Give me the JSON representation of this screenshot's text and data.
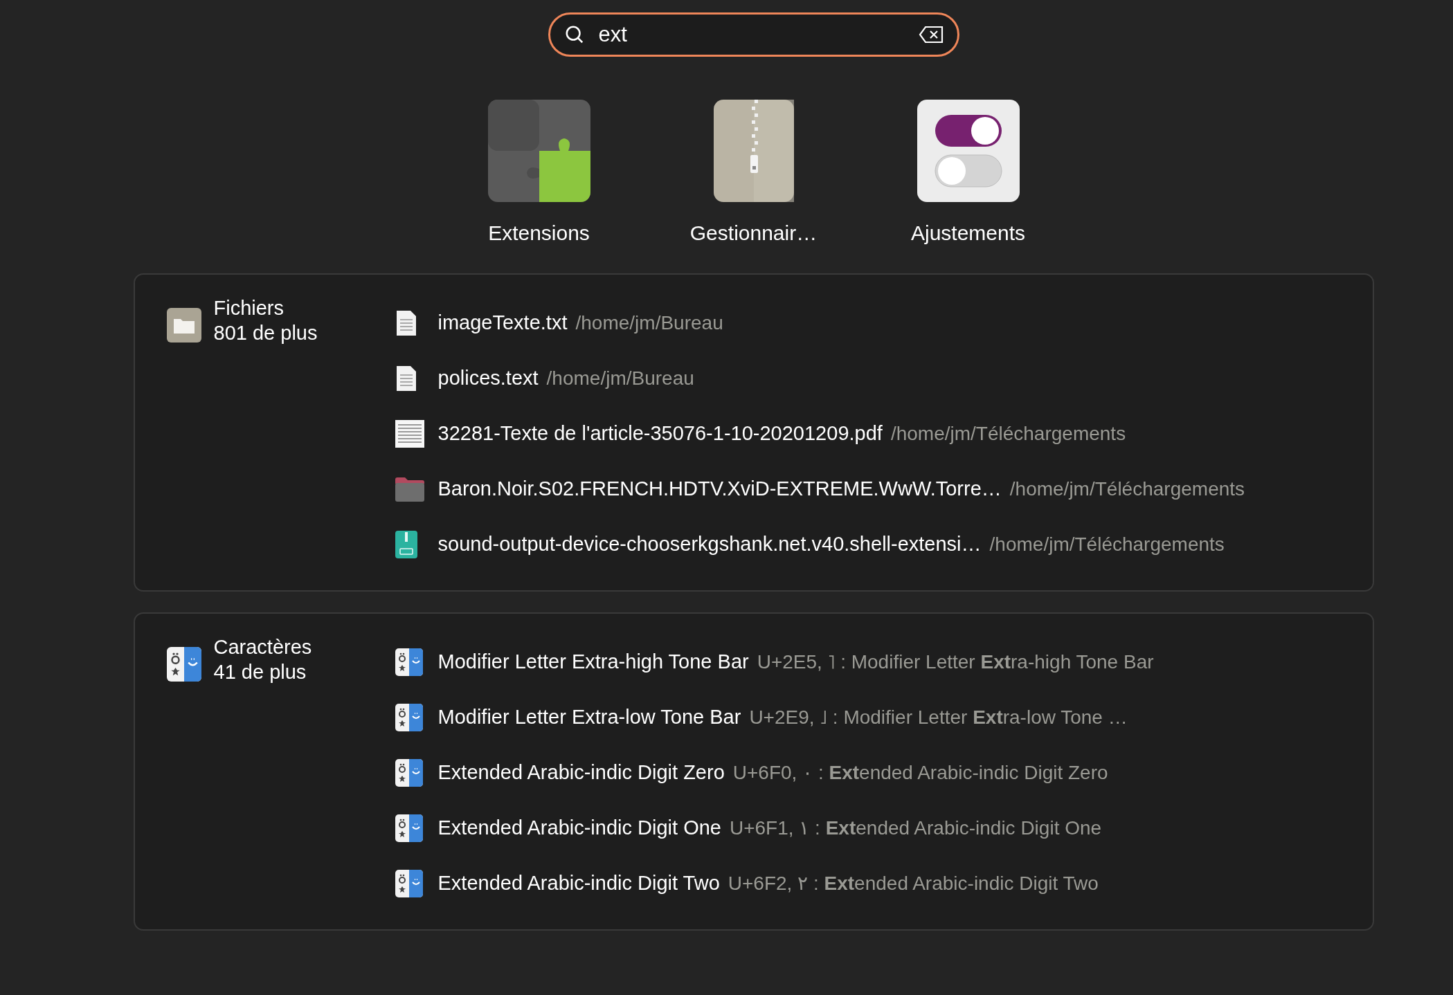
{
  "search": {
    "value": "ext"
  },
  "apps": [
    {
      "kind": "puzzle",
      "label": "Extensions"
    },
    {
      "kind": "zipper",
      "label": "Gestionnair…"
    },
    {
      "kind": "toggles",
      "label": "Ajustements"
    }
  ],
  "sections": [
    {
      "kind": "files",
      "title": "Fichiers",
      "count": "801 de plus",
      "results": [
        {
          "kind": "text",
          "name": "imageTexte.txt",
          "detail": "/home/jm/Bureau"
        },
        {
          "kind": "text",
          "name": "polices.text",
          "detail": "/home/jm/Bureau"
        },
        {
          "kind": "pdf",
          "name": "32281-Texte de l'article-35076-1-10-20201209.pdf",
          "detail": "/home/jm/Téléchargements"
        },
        {
          "kind": "folder",
          "name": "Baron.Noir.S02.FRENCH.HDTV.XviD-EXTREME.WwW.Torre…",
          "detail": "/home/jm/Téléchargements"
        },
        {
          "kind": "zip",
          "name": "sound-output-device-chooserkgshank.net.v40.shell-extensi…",
          "detail": "/home/jm/Téléchargements"
        }
      ]
    },
    {
      "kind": "characters",
      "title": "Caractères",
      "count": "41 de plus",
      "results": [
        {
          "kind": "char",
          "name": "Modifier Letter Extra-high Tone Bar",
          "detail": "U+2E5, ˥ : Modifier Letter **Ext**ra-high Tone Bar"
        },
        {
          "kind": "char",
          "name": "Modifier Letter Extra-low Tone Bar",
          "detail": "U+2E9, ˩ : Modifier Letter **Ext**ra-low Tone …"
        },
        {
          "kind": "char",
          "name": "Extended Arabic-indic Digit Zero",
          "detail": "U+6F0, ۰ : **Ext**ended Arabic-indic Digit Zero"
        },
        {
          "kind": "char",
          "name": "Extended Arabic-indic Digit One",
          "detail": "U+6F1, ۱ : **Ext**ended Arabic-indic Digit One"
        },
        {
          "kind": "char",
          "name": "Extended Arabic-indic Digit Two",
          "detail": "U+6F2, ۲ : **Ext**ended Arabic-indic Digit Two"
        }
      ]
    }
  ]
}
